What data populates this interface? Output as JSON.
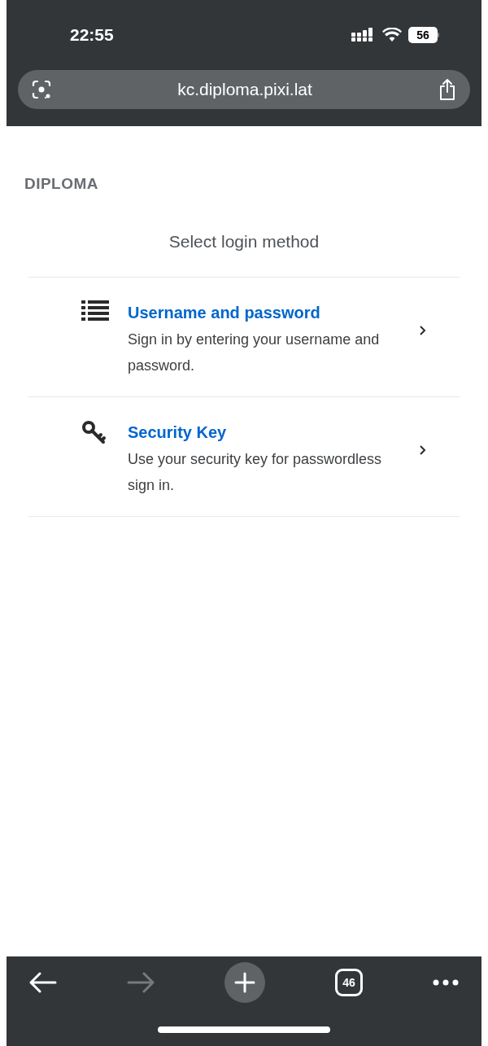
{
  "status_bar": {
    "time": "22:55",
    "battery": "56"
  },
  "address_bar": {
    "url": "kc.diploma.pixi.lat"
  },
  "realm": "DIPLOMA",
  "heading": "Select login method",
  "methods": [
    {
      "kind": "list",
      "title": "Username and password",
      "description": "Sign in by entering your username and password."
    },
    {
      "kind": "key",
      "title": "Security Key",
      "description": "Use your security key for passwordless sign in."
    }
  ],
  "toolbar": {
    "back_disabled": false,
    "forward_disabled": true,
    "tab_count": "46"
  }
}
